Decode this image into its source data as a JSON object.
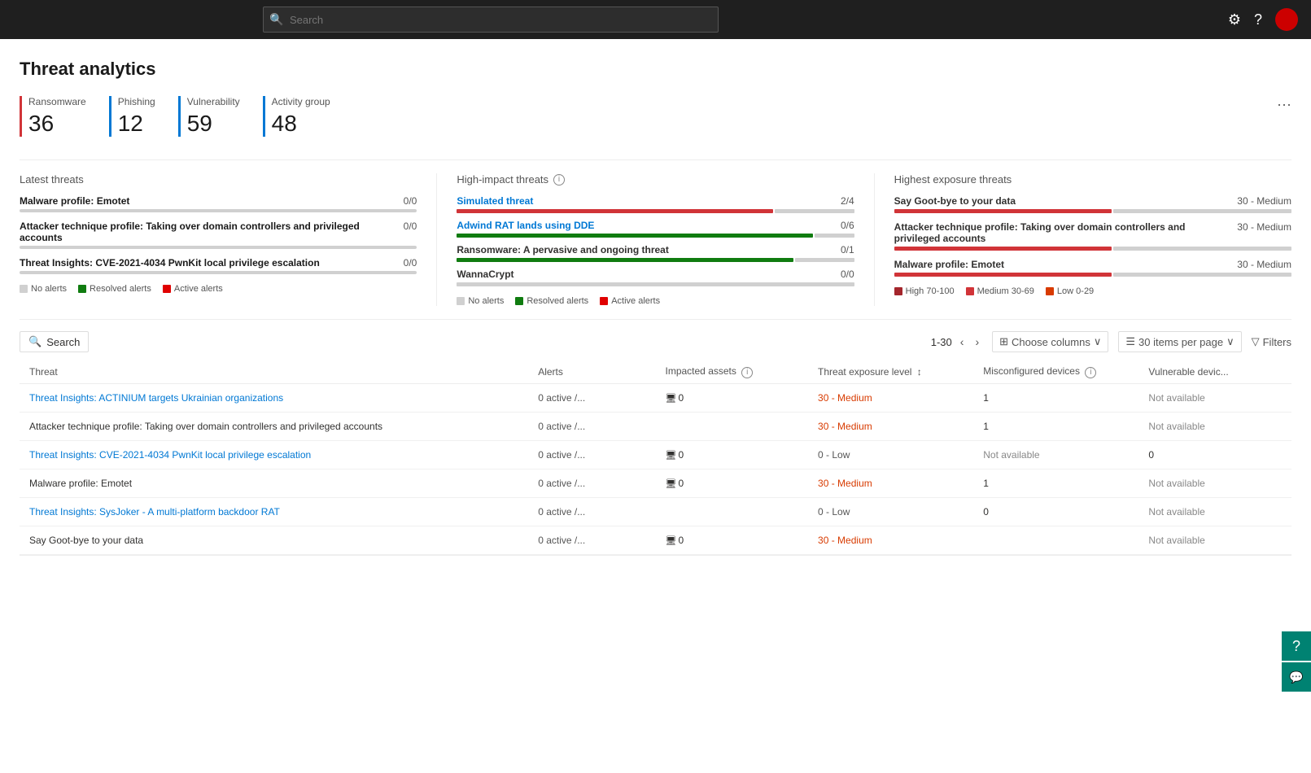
{
  "topbar": {
    "search_placeholder": "Search",
    "settings_icon": "⚙",
    "help_icon": "?",
    "gear_title": "Settings",
    "help_title": "Help"
  },
  "page": {
    "title": "Threat analytics"
  },
  "stats": [
    {
      "label": "Ransomware",
      "value": "36",
      "color": "#d13438"
    },
    {
      "label": "Phishing",
      "value": "12",
      "color": "#0078d4"
    },
    {
      "label": "Vulnerability",
      "value": "59",
      "color": "#0078d4"
    },
    {
      "label": "Activity group",
      "value": "48",
      "color": "#0078d4"
    }
  ],
  "latest_threats": {
    "title": "Latest threats",
    "items": [
      {
        "name": "Malware profile: Emotet",
        "count": "0/0",
        "red_pct": 0,
        "green_pct": 0
      },
      {
        "name": "Attacker technique profile: Taking over domain controllers and privileged accounts",
        "count": "0/0",
        "red_pct": 0,
        "green_pct": 0
      },
      {
        "name": "Threat Insights: CVE-2021-4034 PwnKit local privilege escalation",
        "count": "0/0",
        "red_pct": 0,
        "green_pct": 0
      }
    ],
    "legend": [
      {
        "label": "No alerts",
        "color": "#d0d0d0"
      },
      {
        "label": "Resolved alerts",
        "color": "#107c10"
      },
      {
        "label": "Active alerts",
        "color": "#e00000"
      }
    ]
  },
  "high_impact": {
    "title": "High-impact threats",
    "items": [
      {
        "name": "Simulated threat",
        "count": "2/4",
        "red_pct": 80,
        "green_pct": 15
      },
      {
        "name": "Adwind RAT lands using DDE",
        "count": "0/6",
        "red_pct": 0,
        "green_pct": 90
      },
      {
        "name": "Ransomware: A pervasive and ongoing threat",
        "count": "0/1",
        "red_pct": 0,
        "green_pct": 85
      },
      {
        "name": "WannaCrypt",
        "count": "0/0",
        "red_pct": 0,
        "green_pct": 0
      }
    ],
    "legend": [
      {
        "label": "No alerts",
        "color": "#d0d0d0"
      },
      {
        "label": "Resolved alerts",
        "color": "#107c10"
      },
      {
        "label": "Active alerts",
        "color": "#e00000"
      }
    ]
  },
  "highest_exposure": {
    "title": "Highest exposure threats",
    "items": [
      {
        "name": "Say Goot-bye to your data",
        "score": "30 - Medium",
        "red_pct": 55,
        "gray_pct": 45
      },
      {
        "name": "Attacker technique profile: Taking over domain controllers and privileged accounts",
        "score": "30 - Medium",
        "red_pct": 55,
        "gray_pct": 45
      },
      {
        "name": "Malware profile: Emotet",
        "score": "30 - Medium",
        "red_pct": 55,
        "gray_pct": 45
      }
    ],
    "legend": [
      {
        "label": "High 70-100",
        "color": "#a4262c"
      },
      {
        "label": "Medium 30-69",
        "color": "#d13438"
      },
      {
        "label": "Low 0-29",
        "color": "#d83b01"
      }
    ]
  },
  "table": {
    "search_placeholder": "Search",
    "pagination": "1-30",
    "choose_columns": "Choose columns",
    "items_per_page": "30 items per page",
    "filters": "Filters",
    "columns": [
      "Threat",
      "Alerts",
      "Impacted assets",
      "Threat exposure level",
      "Misconfigured devices",
      "Vulnerable devic..."
    ],
    "rows": [
      {
        "threat": "Threat Insights: ACTINIUM targets Ukrainian organizations",
        "is_link": true,
        "alerts": "0 active /...",
        "assets": "0",
        "exposure": "30 - Medium",
        "misconfigured": "1",
        "vulnerable": "Not available"
      },
      {
        "threat": "Attacker technique profile: Taking over domain controllers and privileged accounts",
        "is_link": false,
        "alerts": "0 active /...",
        "assets": "",
        "exposure": "30 - Medium",
        "misconfigured": "1",
        "vulnerable": "Not available"
      },
      {
        "threat": "Threat Insights: CVE-2021-4034 PwnKit local privilege escalation",
        "is_link": true,
        "alerts": "0 active /...",
        "assets": "0",
        "exposure": "0 - Low",
        "misconfigured": "Not available",
        "vulnerable": "0"
      },
      {
        "threat": "Malware profile: Emotet",
        "is_link": false,
        "alerts": "0 active /...",
        "assets": "0",
        "exposure": "30 - Medium",
        "misconfigured": "1",
        "vulnerable": "Not available"
      },
      {
        "threat": "Threat Insights: SysJoker - A multi-platform backdoor RAT",
        "is_link": true,
        "alerts": "0 active /...",
        "assets": "",
        "exposure": "0 - Low",
        "misconfigured": "0",
        "vulnerable": "Not available"
      },
      {
        "threat": "Say Goot-bye to your data",
        "is_link": false,
        "alerts": "0 active /...",
        "assets": "0",
        "exposure": "30 - Medium",
        "misconfigured": "",
        "vulnerable": "Not available"
      }
    ]
  },
  "icons": {
    "search": "🔍",
    "chevron_down": "∨",
    "chevron_left": "‹",
    "chevron_right": "›",
    "columns_icon": "⊞",
    "filter_icon": "⊿",
    "device_icon": "🖥",
    "ellipsis": "···"
  }
}
